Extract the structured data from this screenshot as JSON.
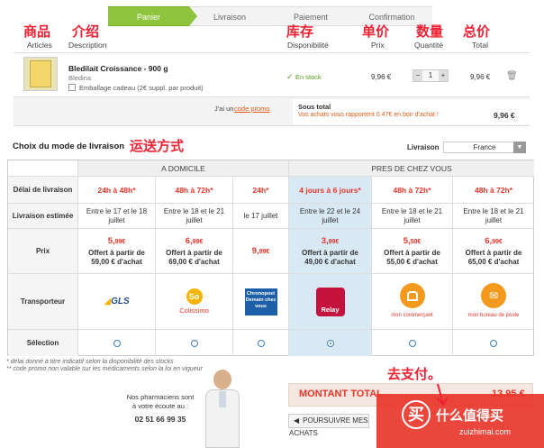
{
  "steps": [
    "Panier",
    "Livraison",
    "Paiement",
    "Confirmation"
  ],
  "annotations": {
    "product": "商品",
    "intro": "介绍",
    "stock": "库存",
    "unit_price": "单价",
    "quantity": "数量",
    "total_price": "总价",
    "shipping_method": "运送方式",
    "pay": "去支付。"
  },
  "cart_header": {
    "articles": "Articles",
    "description": "Description",
    "disponibilite": "Disponibilité",
    "prix": "Prix",
    "quantite": "Quantité",
    "total": "Total"
  },
  "item": {
    "name": "Bledilait Croissance - 900 g",
    "brand": "Bledina",
    "gift_wrap": "Emballage cadeau (2€ suppl. par produit)",
    "stock": "En stock",
    "price": "9,96 €",
    "quantity": "1",
    "total": "9,96 €"
  },
  "summary": {
    "promo_prefix": "J'ai un",
    "promo_link": "code promo",
    "subtotal_label": "Sous total",
    "points_msg": "Vos achats vous rapportent 0.47€ en bon d'achat !",
    "subtotal": "9,96 €"
  },
  "delivery": {
    "heading": "Choix du mode de livraison",
    "country_label": "Livraison",
    "country": "France",
    "group_home": "A DOMICILE",
    "group_relay": "PRES DE CHEZ VOUS",
    "row_labels": [
      "Délai de livraison",
      "Livraison estimée",
      "Prix",
      "Transporteur",
      "Sélection"
    ],
    "options": [
      {
        "delay": "24h à 48h*",
        "date": "Entre le 17 et le 18 juillet",
        "price_int": "5,",
        "price_dec": "99€",
        "offer": "Offert à partir de 59,00 € d'achat",
        "carrier": "GLS",
        "selected": false
      },
      {
        "delay": "48h à 72h*",
        "date": "Entre le 18 et le 21 juillet",
        "price_int": "6,",
        "price_dec": "99€",
        "offer": "Offert à partir de 69,00 € d'achat",
        "carrier": "Colissimo",
        "selected": false
      },
      {
        "delay": "24h*",
        "date": "le 17 juillet",
        "price_int": "9,",
        "price_dec": "99€",
        "offer": "",
        "carrier": "Chronopost Demain chez vous",
        "selected": false
      },
      {
        "delay": "4 jours à 6 jours*",
        "date": "Entre le 22 et le 24 juillet",
        "price_int": "3,",
        "price_dec": "99€",
        "offer": "Offert à partir de 49,00 € d'achat",
        "carrier": "Relay",
        "selected": true
      },
      {
        "delay": "48h à 72h*",
        "date": "Entre le 18 et le 21 juillet",
        "price_int": "5,",
        "price_dec": "50€",
        "offer": "Offert à partir de 55,00 € d'achat",
        "carrier": "mon commerçant",
        "selected": false
      },
      {
        "delay": "48h à 72h*",
        "date": "Entre le 18 et le 21 juillet",
        "price_int": "6,",
        "price_dec": "99€",
        "offer": "Offert à partir de 65,00 € d'achat",
        "carrier": "mon bureau de poste",
        "selected": false
      }
    ],
    "footnote1": "* délai donné à titre indicatif selon la disponibilité des stocks",
    "footnote2": "** code promo non valable sur les médicaments selon la loi en vigueur"
  },
  "pharmacist": {
    "line1": "Nos pharmaciens sont",
    "line2": "à votre écoute au :",
    "phone": "02 51 66 99 35"
  },
  "total_box": {
    "label": "MONTANT TOTAL",
    "amount": "13,95 €"
  },
  "continue_btn": "POURSUIVRE MES ACHATS",
  "watermark": {
    "char": "买",
    "title": "什么值得买",
    "url": "zuizhimai.com"
  },
  "colors": {
    "accent": "#8fc43f",
    "annotation": "#ee2233",
    "price_red": "#e7362b",
    "relay_bg": "#d8e9f4"
  }
}
